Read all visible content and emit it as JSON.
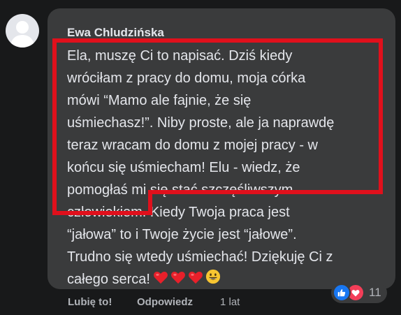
{
  "comment": {
    "author": "Ewa Chludzińska",
    "lines": [
      "Ela, muszę Ci to napisać. Dziś kiedy",
      "wróciłam z pracy do domu, moja córka",
      "mówi “Mamo ale fajnie, że się",
      "uśmiechasz!”. Niby proste, ale ja naprawdę",
      "teraz wracam do domu z mojej pracy - w",
      "końcu się uśmiecham! Elu - wiedz, że",
      "pomogłaś mi się stać szczęśliwszym",
      "człowiekiem. Kiedy Twoja praca jest",
      "“jałowa” to i Twoje życie jest “jałowe”.",
      "Trudno się wtedy uśmiechać! Dziękuję Ci z",
      "całego serca!"
    ],
    "emojis": [
      "heart-emoji",
      "heart-emoji",
      "heart-emoji",
      "smile-emoji"
    ],
    "reactions": {
      "icons": [
        "like-icon",
        "love-icon"
      ],
      "count": "11"
    }
  },
  "actions": {
    "like_label": "Lubię to!",
    "reply_label": "Odpowiedz",
    "time": "1 lat"
  },
  "colors": {
    "background": "#18191a",
    "bubble": "#3a3b3c",
    "text": "#e4e6eb",
    "secondary": "#b0b3b8",
    "highlight": "#e0101c",
    "like": "#1877f2",
    "love": "#f33e58"
  }
}
